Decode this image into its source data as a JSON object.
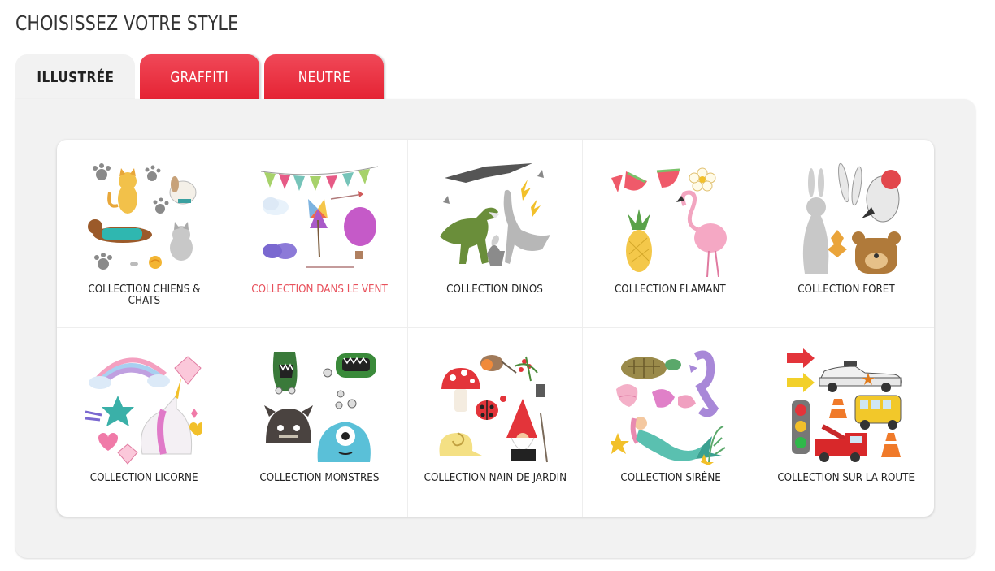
{
  "page": {
    "title": "CHOISISSEZ VOTRE STYLE"
  },
  "tabs": [
    {
      "label": "ILLUSTRÉE",
      "active": true
    },
    {
      "label": "GRAFFITI",
      "active": false
    },
    {
      "label": "NEUTRE",
      "active": false
    }
  ],
  "colors": {
    "accent": "#e52333",
    "panel": "#f2f2f2",
    "hover_label": "#e8505b"
  },
  "collections": [
    {
      "label": "COLLECTION CHIENS & CHATS",
      "icon": "cat-dog-icon"
    },
    {
      "label": "COLLECTION DANS LE VENT",
      "icon": "pinwheel-balloon-icon",
      "highlighted": true
    },
    {
      "label": "COLLECTION DINOS",
      "icon": "dinosaur-icon"
    },
    {
      "label": "COLLECTION FLAMANT",
      "icon": "flamingo-icon"
    },
    {
      "label": "COLLECTION FÔRET",
      "icon": "forest-animals-icon"
    },
    {
      "label": "COLLECTION LICORNE",
      "icon": "unicorn-icon"
    },
    {
      "label": "COLLECTION MONSTRES",
      "icon": "monster-icon"
    },
    {
      "label": "COLLECTION NAIN DE JARDIN",
      "icon": "garden-gnome-icon"
    },
    {
      "label": "COLLECTION SIRÈNE",
      "icon": "mermaid-icon"
    },
    {
      "label": "COLLECTION SUR LA ROUTE",
      "icon": "vehicles-icon"
    }
  ]
}
